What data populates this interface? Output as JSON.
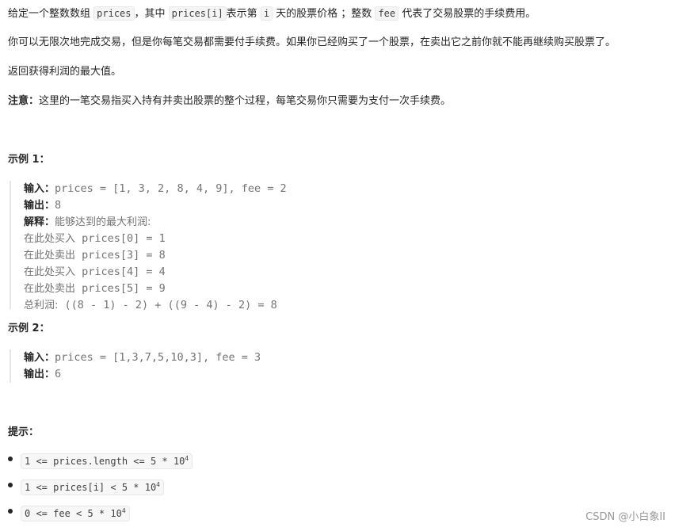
{
  "problem": {
    "p1": {
      "t1": "给定一个整数数组 ",
      "c1": "prices",
      "t2": "，其中 ",
      "c2": "prices[i]",
      "t3": "表示第 ",
      "c3": "i",
      "t4": " 天的股票价格 ；整数 ",
      "c4": "fee",
      "t5": " 代表了交易股票的手续费用。"
    },
    "p2": "你可以无限次地完成交易，但是你每笔交易都需要付手续费。如果你已经购买了一个股票，在卖出它之前你就不能再继续购买股票了。",
    "p3": "返回获得利润的最大值。",
    "p4": {
      "label": "注意：",
      "text": "这里的一笔交易指买入持有并卖出股票的整个过程，每笔交易你只需要为支付一次手续费。"
    }
  },
  "examples": [
    {
      "title": "示例 1：",
      "input_label": "输入：",
      "input": "prices = [1, 3, 2, 8, 4, 9], fee = 2",
      "output_label": "输出：",
      "output": "8",
      "explain_label": "解释：",
      "explain": "能够达到的最大利润:",
      "steps": [
        {
          "zh": "在此处买入",
          "code": " prices[0] = 1"
        },
        {
          "zh": "在此处卖出",
          "code": " prices[3] = 8"
        },
        {
          "zh": "在此处买入",
          "code": " prices[4] = 4"
        },
        {
          "zh": "在此处卖出",
          "code": " prices[5] = 9"
        }
      ],
      "total_label": "总利润:",
      "total": " ((8 - 1) - 2) + ((9 - 4) - 2) = 8"
    },
    {
      "title": "示例 2：",
      "input_label": "输入：",
      "input": "prices = [1,3,7,5,10,3], fee = 3",
      "output_label": "输出：",
      "output": "6"
    }
  ],
  "hints": {
    "title": "提示：",
    "items": [
      {
        "text": "1 <= prices.length <= 5 * 10",
        "sup": "4"
      },
      {
        "text": "1 <= prices[i] < 5 * 10",
        "sup": "4"
      },
      {
        "text": "0 <= fee < 5 * 10",
        "sup": "4"
      }
    ]
  },
  "watermark": "CSDN @小白象II"
}
